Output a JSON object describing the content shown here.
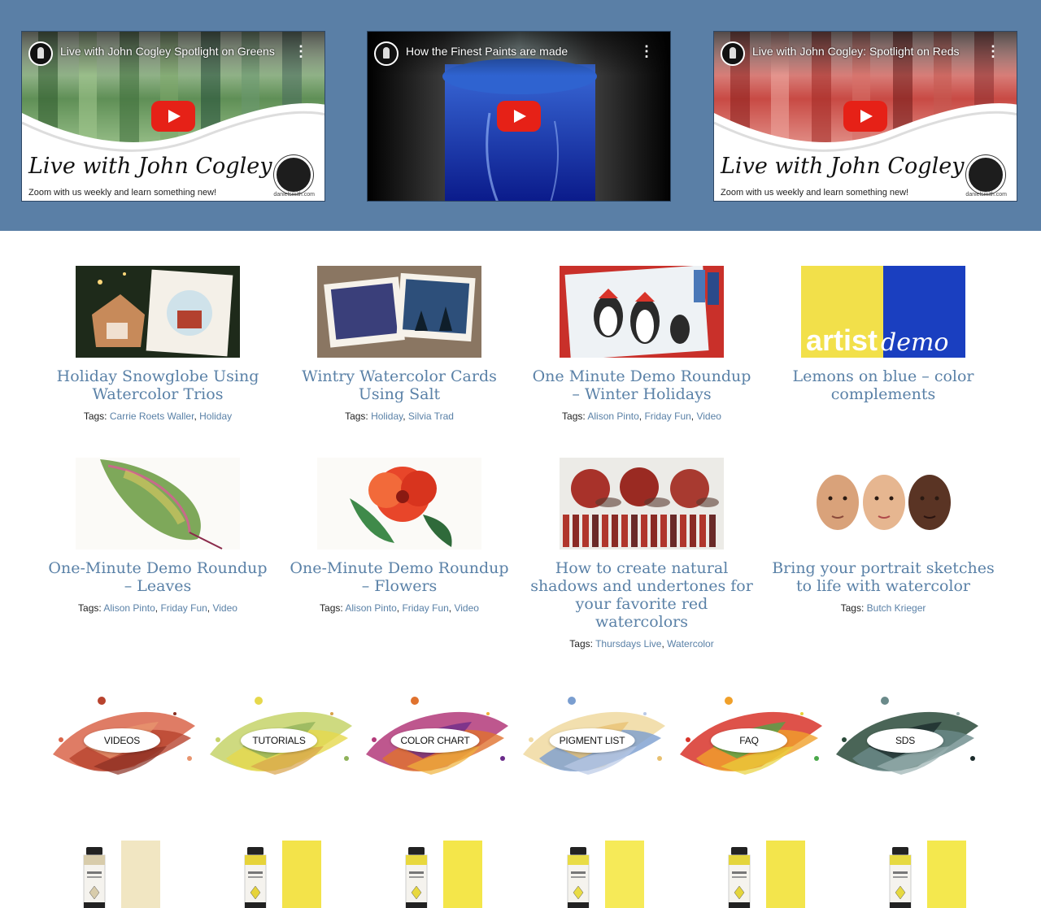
{
  "videos": [
    {
      "title": "Live with John Cogley Spotlight on Greens",
      "overlay": "Live with John Cogley",
      "tagline": "Zoom with us weekly and learn something new!",
      "site": "danielsmith.com",
      "palette": [
        "#c8e0b8",
        "#5f8f56",
        "#2f5a2e",
        "#8fb37e"
      ]
    },
    {
      "title": "How the Finest Paints are made",
      "overlay": "",
      "tagline": "",
      "site": "",
      "palette": [
        "#0a1e8a",
        "#2a55c8",
        "#071258",
        "#7aa0e0"
      ]
    },
    {
      "title": "Live with John Cogley: Spotlight on Reds",
      "overlay": "Live with John Cogley",
      "tagline": "Zoom with us weekly and learn something new!",
      "site": "danielsmith.com",
      "palette": [
        "#f0b8b5",
        "#c84a44",
        "#8a1f1c",
        "#e07a70"
      ]
    }
  ],
  "articles": [
    {
      "title": "Holiday Snowglobe Using Watercolor Trios",
      "tags_label": "Tags:",
      "tags": [
        "Carrie Roets Waller",
        "Holiday"
      ],
      "image": "snowglobe-image"
    },
    {
      "title": "Wintry Watercolor Cards Using Salt",
      "tags_label": "Tags:",
      "tags": [
        "Holiday",
        "Silvia Trad"
      ],
      "image": "winter-cards-image"
    },
    {
      "title": "One Minute Demo Roundup – Winter Holidays",
      "tags_label": "Tags:",
      "tags": [
        "Alison Pinto",
        "Friday Fun",
        "Video"
      ],
      "image": "penguins-image"
    },
    {
      "title": "Lemons on blue – color complements",
      "tags_label": "",
      "tags": [],
      "image": "artist-demo-image",
      "logo_word1": "artist",
      "logo_word2": "demo"
    },
    {
      "title": "One-Minute Demo Roundup – Leaves",
      "tags_label": "Tags:",
      "tags": [
        "Alison Pinto",
        "Friday Fun",
        "Video"
      ],
      "image": "leaf-image"
    },
    {
      "title": "One-Minute Demo Roundup – Flowers",
      "tags_label": "Tags:",
      "tags": [
        "Alison Pinto",
        "Friday Fun",
        "Video"
      ],
      "image": "flower-image"
    },
    {
      "title": "How to create natural shadows and undertones for your favorite red watercolors",
      "tags_label": "Tags:",
      "tags": [
        "Thursdays Live",
        "Watercolor"
      ],
      "image": "red-apples-image"
    },
    {
      "title": "Bring your portrait sketches to life with watercolor",
      "tags_label": "Tags:",
      "tags": [
        "Butch Krieger"
      ],
      "image": "portraits-image"
    }
  ],
  "categories": [
    {
      "label": "VIDEOS",
      "colors": [
        "#d9654a",
        "#b8432e",
        "#e8956f",
        "#8a2f22"
      ]
    },
    {
      "label": "TUTORIALS",
      "colors": [
        "#c6d36a",
        "#e6d84c",
        "#8fb25a",
        "#d9a24a"
      ]
    },
    {
      "label": "COLOR CHART",
      "colors": [
        "#b33a7a",
        "#e0722e",
        "#6a2a8a",
        "#f0b23a"
      ]
    },
    {
      "label": "PIGMENT LIST",
      "colors": [
        "#f0d9a0",
        "#7a9ed0",
        "#e8c070",
        "#b9c9e6"
      ]
    },
    {
      "label": "FAQ",
      "colors": [
        "#d8342a",
        "#f0a02a",
        "#4aa84a",
        "#e8d23a"
      ]
    },
    {
      "label": "SDS",
      "colors": [
        "#2a4a3a",
        "#6a8a8a",
        "#1a2a2a",
        "#9ab0b0"
      ]
    }
  ],
  "paint_tubes": [
    {
      "swatch": "#f1e6c2",
      "cap": "#d8ccab"
    },
    {
      "swatch": "#f3e34a",
      "cap": "#e6d33a"
    },
    {
      "swatch": "#f4e64a",
      "cap": "#e8d83e"
    },
    {
      "swatch": "#f6ea58",
      "cap": "#e9dc46"
    },
    {
      "swatch": "#f3e54c",
      "cap": "#e4d53c"
    },
    {
      "swatch": "#f4e84e",
      "cap": "#e6d940"
    }
  ]
}
